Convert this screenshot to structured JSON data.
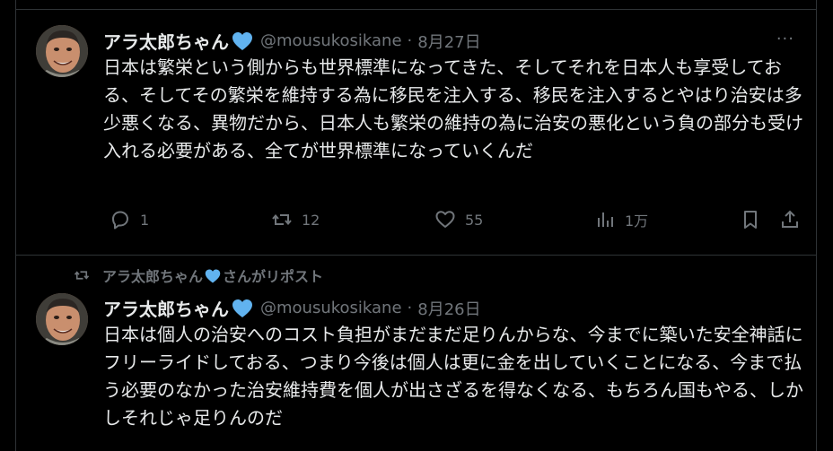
{
  "colors": {
    "background": "#000000",
    "text_primary": "#e7e9ea",
    "text_secondary": "#71767b",
    "verified_heart": "#61b3f0",
    "border": "#2f3336"
  },
  "posts": [
    {
      "author_name": "アラ太郎ちゃん",
      "author_badge_icon": "blue-heart-icon",
      "handle": "@mousukosikane",
      "separator": "·",
      "date": "8月27日",
      "more_label": "···",
      "text": "日本は繁栄という側からも世界標準になってきた、そしてそれを日本人も享受しておる、そしてその繁栄を維持する為に移民を注入する、移民を注入するとやはり治安は多少悪くなる、異物だから、日本人も繁栄の維持の為に治安の悪化という負の部分も受け入れる必要がある、全てが世界標準になっていくんだ",
      "actions": {
        "reply_count": "1",
        "repost_count": "12",
        "like_count": "55",
        "views_count": "1万"
      }
    },
    {
      "repost_banner": "アラ太郎ちゃん",
      "repost_banner_suffix": "さんがリポスト",
      "author_name": "アラ太郎ちゃん",
      "handle": "@mousukosikane",
      "separator": "·",
      "date": "8月26日",
      "text": "日本は個人の治安へのコスト負担がまだまだ足りんからな、今までに築いた安全神話にフリーライドしておる、つまり今後は個人は更に金を出していくことになる、今まで払う必要のなかった治安維持費を個人が出さざるを得なくなる、もちろん国もやる、しかしそれじゃ足りんのだ"
    }
  ]
}
